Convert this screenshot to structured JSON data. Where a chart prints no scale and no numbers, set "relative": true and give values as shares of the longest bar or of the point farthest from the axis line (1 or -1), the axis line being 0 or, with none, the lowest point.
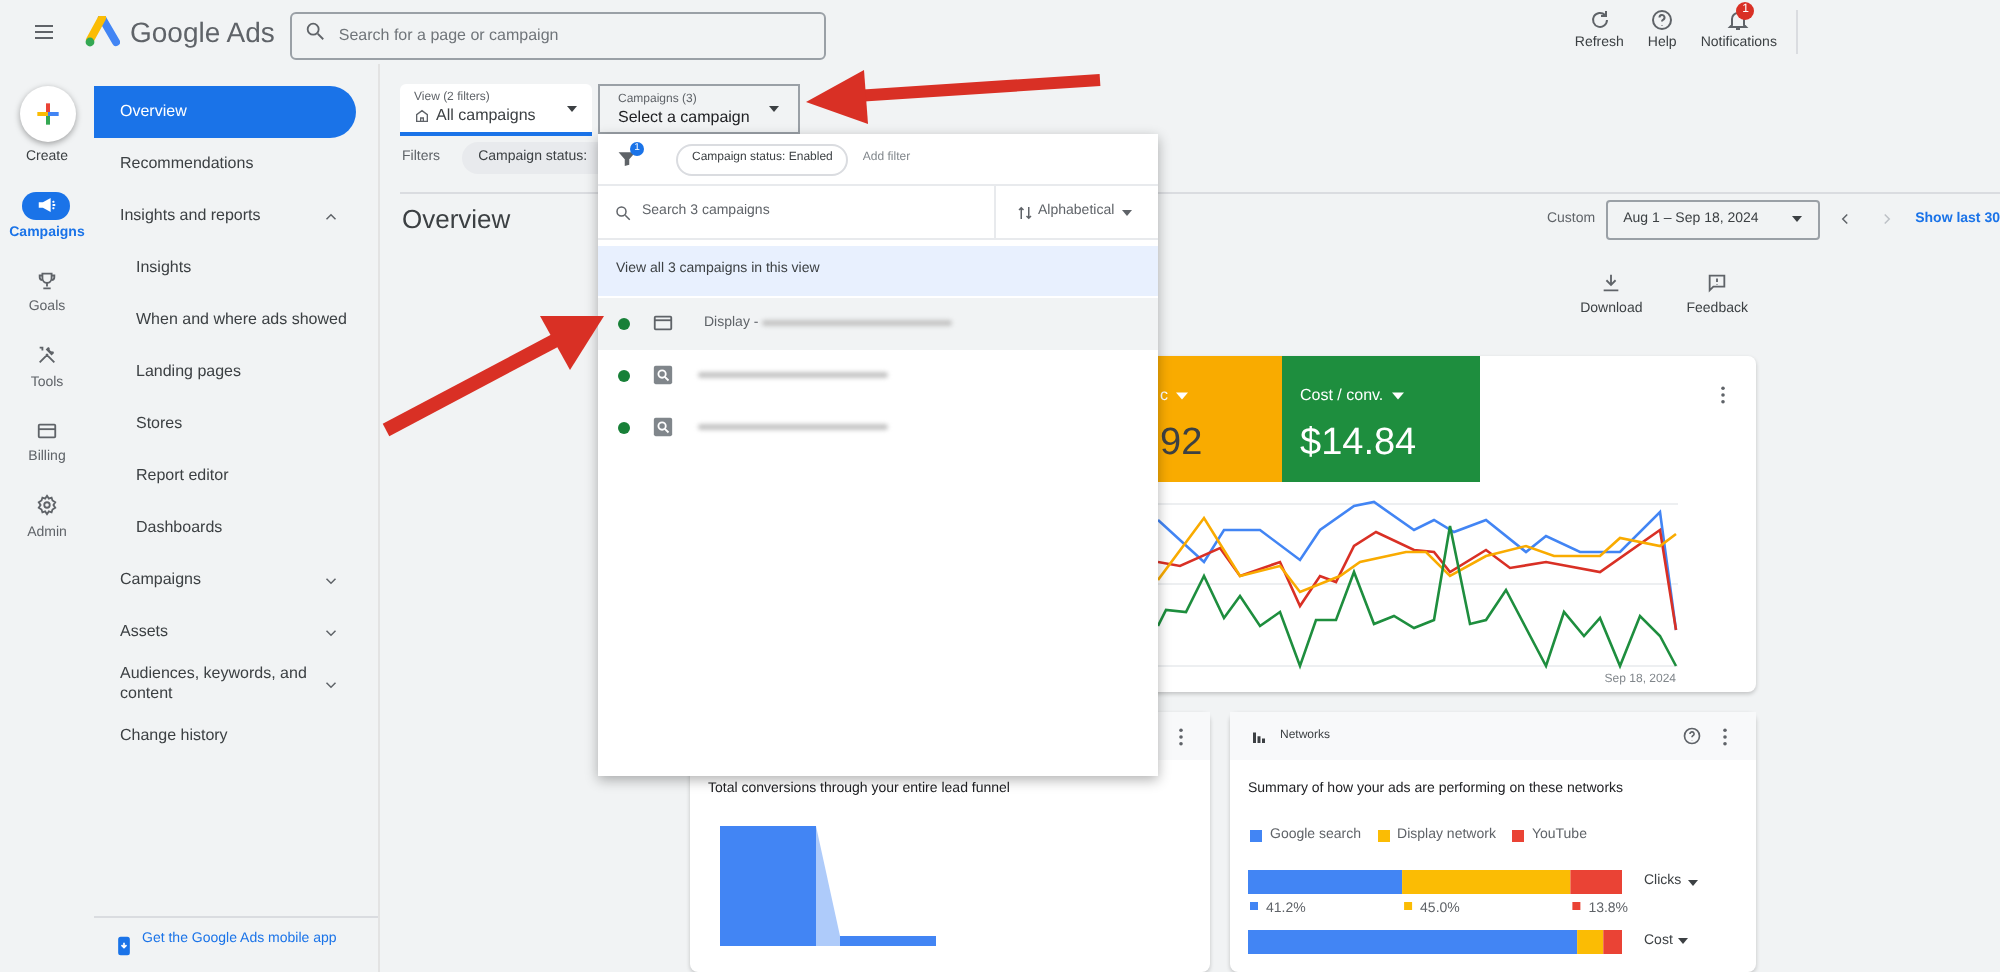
{
  "header": {
    "product": "Google Ads",
    "search": {
      "placeholder": "Search for a page or campaign"
    },
    "actions": [
      {
        "kind": "refresh",
        "label": "Refresh"
      },
      {
        "kind": "help",
        "label": "Help"
      },
      {
        "kind": "notifications",
        "label": "Notifications",
        "badge": "1"
      }
    ]
  },
  "rail": [
    {
      "kind": "create",
      "label": "Create"
    },
    {
      "kind": "campaigns",
      "label": "Campaigns",
      "selected": true
    },
    {
      "kind": "goals",
      "label": "Goals",
      "selected": false
    },
    {
      "kind": "tools",
      "label": "Tools",
      "selected": false
    },
    {
      "kind": "billing",
      "label": "Billing",
      "selected": false
    },
    {
      "kind": "admin",
      "label": "Admin",
      "selected": false
    }
  ],
  "nav": [
    {
      "label": "Overview",
      "selected": true
    },
    {
      "label": "Recommendations",
      "selected": false
    },
    {
      "label": "Insights and reports",
      "selected": false,
      "expanded": true,
      "children": [
        {
          "label": "Insights",
          "selected": false
        },
        {
          "label": "When and where ads showed",
          "selected": false
        },
        {
          "label": "Landing pages",
          "selected": false
        },
        {
          "label": "Stores",
          "selected": false
        },
        {
          "label": "Report editor",
          "selected": false
        },
        {
          "label": "Dashboards",
          "selected": false
        }
      ]
    },
    {
      "label": "Campaigns",
      "selected": false,
      "expanded": false
    },
    {
      "label": "Assets",
      "selected": false,
      "expanded": false
    },
    {
      "label": "Audiences, keywords, and content",
      "selected": false,
      "expanded": false
    },
    {
      "label": "Change history",
      "selected": false
    }
  ],
  "mobile_app_link": "Get the Google Ads mobile app",
  "view_selector": {
    "label": "View (2 filters)",
    "value": "All campaigns"
  },
  "campaign_selector": {
    "label": "Campaigns (3)",
    "value": "Select a campaign"
  },
  "filters": {
    "label": "Filters",
    "chip": "Campaign status:"
  },
  "page_title": "Overview",
  "date_range": {
    "label": "Custom",
    "value": "Aug 1 – Sep 18, 2024",
    "show_last": "Show last 30"
  },
  "tools": [
    {
      "kind": "download",
      "label": "Download"
    },
    {
      "kind": "feedback",
      "label": "Feedback"
    }
  ],
  "performance_card": {
    "metrics": [
      {
        "label": "c",
        "value": "92",
        "color": "#f9ab00"
      },
      {
        "label": "Cost / conv.",
        "value": "$14.84",
        "color": "#1e8e3e"
      }
    ],
    "end_date": "Sep 18, 2024"
  },
  "funnel_card": {
    "title": "Total conversions through your entire lead funnel"
  },
  "networks_card": {
    "title": "Networks",
    "summary": "Summary of how your ads are performing on these networks",
    "chart_data": {
      "type": "bar",
      "orientation": "horizontal",
      "stacked": true,
      "relative": true,
      "legend": "top",
      "value_labels": [
        [
          "41.2%"
        ],
        [
          "45.0%"
        ],
        [
          "13.8%"
        ]
      ],
      "categories": [
        "Clicks",
        "Cost"
      ],
      "series": [
        {
          "name": "Google search",
          "color": "#4285f4",
          "values": [
            0.412,
            0.88
          ]
        },
        {
          "name": "Display network",
          "color": "#fbbc04",
          "values": [
            0.45,
            0.07
          ]
        },
        {
          "name": "YouTube",
          "color": "#ea4335",
          "values": [
            0.138,
            0.05
          ]
        }
      ]
    }
  },
  "dropdown": {
    "filter_count": "1",
    "chip": "Campaign status: Enabled",
    "add_filter": "Add filter",
    "search": {
      "placeholder": "Search 3 campaigns"
    },
    "sort": "Alphabetical",
    "view_all": "View all 3 campaigns in this view",
    "campaigns": [
      {
        "kind": "display",
        "name": "Display -",
        "redacted": true,
        "color": "#188038",
        "selected": true
      },
      {
        "kind": "search",
        "redacted": true,
        "color": "#188038",
        "selected": false
      },
      {
        "kind": "search",
        "redacted": true,
        "color": "#188038",
        "selected": false
      }
    ]
  }
}
